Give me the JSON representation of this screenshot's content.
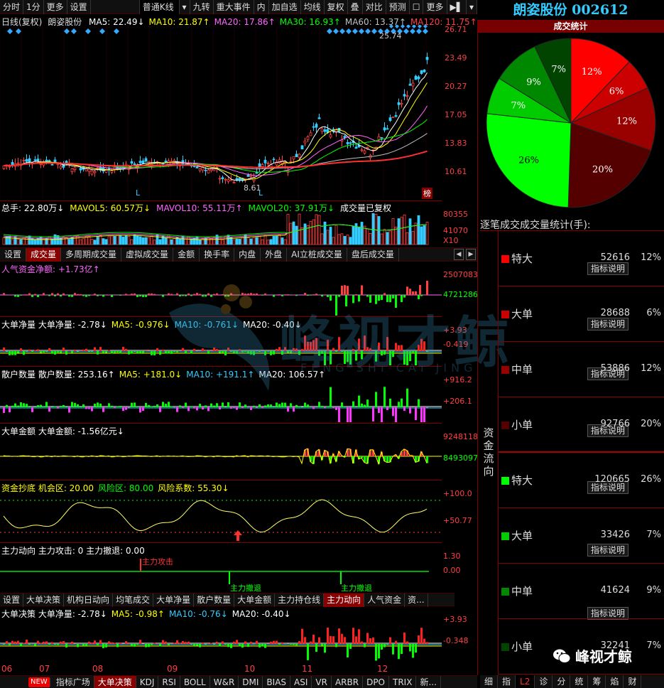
{
  "toolbar": {
    "items": [
      "分时",
      "1分",
      "更多",
      "设置"
    ],
    "chart_type": "普通K线",
    "buttons": [
      "九转",
      "重大事件",
      "内",
      "加自选",
      "均线",
      "复权",
      "叠",
      "对比",
      "预测",
      "更多"
    ]
  },
  "stock": {
    "name": "朗姿股份",
    "code": "002612"
  },
  "kline": {
    "info": "日线(复权)",
    "stock": "朗姿股份",
    "ma": [
      {
        "text": "MA5: 22.49↓",
        "color": "#ffffff"
      },
      {
        "text": "MA10: 21.87↑",
        "color": "#ffff00"
      },
      {
        "text": "MA20: 17.86↑",
        "color": "#ff66ff"
      },
      {
        "text": "MA30: 16.93↑",
        "color": "#00ff00"
      },
      {
        "text": "MA60: 13.37↑",
        "color": "#c0c0c0"
      },
      {
        "text": "MA120: 11.75↑",
        "color": "#ff4040"
      }
    ],
    "price_axis": [
      "26.71",
      "23.49",
      "20.27",
      "17.05",
      "13.83",
      "10.61"
    ],
    "high": "25.74",
    "low": "8.61",
    "sell_mark": "榜",
    "l_mark": "L"
  },
  "volume": {
    "items": [
      {
        "text": "总手: 22.80万↓",
        "color": "#ffffff"
      },
      {
        "text": "MAVOL5: 60.57万↓",
        "color": "#ffff00"
      },
      {
        "text": "MAVOL10: 55.11万↑",
        "color": "#ff66ff"
      },
      {
        "text": "MAVOL20: 37.91万↓",
        "color": "#00ff00"
      },
      {
        "text": "成交量已复权",
        "color": "#ffffff"
      }
    ],
    "axis": [
      "80355",
      "41070",
      "X10"
    ]
  },
  "tabs1": [
    "设置",
    "成交量",
    "多周期成交量",
    "虚拟成交量",
    "金额",
    "换手率",
    "内盘",
    "外盘",
    "AI立桩成交量",
    "盘后成交量"
  ],
  "explain": "指标说明",
  "p1": {
    "title": "人气资金净额: +1.73亿↑",
    "axis": [
      "2507083",
      "4721286"
    ]
  },
  "p2": {
    "parts": [
      {
        "text": "大单净量 大单净量: -2.78↓",
        "color": "#ffffff"
      },
      {
        "text": "MA5: -0.976↓",
        "color": "#ffff00"
      },
      {
        "text": "MA10: -0.761↓",
        "color": "#33ccff"
      },
      {
        "text": "MA20: -0.40↓",
        "color": "#ffffff"
      }
    ],
    "axis": [
      "+3.93",
      "-0.419"
    ]
  },
  "p3": {
    "parts": [
      {
        "text": "散户数量 散户数量: 253.16↑",
        "color": "#ffffff"
      },
      {
        "text": "MA5: +181.0↓",
        "color": "#ffff00"
      },
      {
        "text": "MA10: +191.1↑",
        "color": "#33ccff"
      },
      {
        "text": "MA20: 106.57↑",
        "color": "#ffffff"
      }
    ],
    "axis": [
      "+916.2",
      "+206.1"
    ]
  },
  "p4": {
    "title": "大单金额 大单金额: -1.56亿元↓",
    "axis": [
      "9248118",
      "8493097"
    ]
  },
  "p5": {
    "parts": [
      {
        "text": "资金抄底 机会区: 20.00",
        "color": "#ffff00"
      },
      {
        "text": "风险区: 80.00",
        "color": "#00ff00"
      },
      {
        "text": "风险系数: 55.30↓",
        "color": "#ffff00"
      }
    ],
    "axis": [
      "+100.0",
      "+50.77"
    ]
  },
  "p6": {
    "title": "主力动向 主力攻击: 0 主力撤退: 0.00",
    "axis": [
      "1.30",
      "0.00"
    ],
    "attack": "主力攻击",
    "retreat": "主力撤退"
  },
  "tabs2": [
    "设置",
    "大单决策",
    "机构日动向",
    "均笔成交",
    "大单净量",
    "散户数量",
    "大单金额",
    "主力持仓线",
    "主力动向",
    "人气资金",
    "资..."
  ],
  "p7": {
    "parts": [
      {
        "text": "大单决策 大单净量: -2.78↓",
        "color": "#ffffff"
      },
      {
        "text": "MA5: -0.98↑",
        "color": "#ffff00"
      },
      {
        "text": "MA10: -0.76↓",
        "color": "#33ccff"
      },
      {
        "text": "MA20: -0.40↓",
        "color": "#ffffff"
      }
    ],
    "axis": [
      "+3.93",
      "-0.348"
    ]
  },
  "months": [
    "06",
    "07",
    "08",
    "09",
    "10",
    "11",
    "12"
  ],
  "bottom_tabs": [
    "NEW",
    "指标广场",
    "大单决策",
    "KDJ",
    "RSI",
    "BOLL",
    "W&R",
    "DMI",
    "BIAS",
    "ASI",
    "VR",
    "ARBR",
    "DPO",
    "TRIX",
    "新..."
  ],
  "watermark": {
    "cn": "峰视才鲸",
    "en": "FENG SHI CAI JING"
  },
  "pie_title": "成交统计",
  "stats": {
    "title": "逐笔成交成交量统计(手):",
    "side": "资金流向",
    "rows": [
      {
        "name": "特大",
        "value": "52616",
        "pct": "12%",
        "color": "#ff0000"
      },
      {
        "name": "大单",
        "value": "28688",
        "pct": "6%",
        "color": "#cc0000"
      },
      {
        "name": "中单",
        "value": "53886",
        "pct": "12%",
        "color": "#990000"
      },
      {
        "name": "小单",
        "value": "92766",
        "pct": "20%",
        "color": "#550000"
      },
      {
        "name": "特大",
        "value": "120665",
        "pct": "26%",
        "color": "#00ff00"
      },
      {
        "name": "大单",
        "value": "33426",
        "pct": "7%",
        "color": "#00cc00"
      },
      {
        "name": "中单",
        "value": "41624",
        "pct": "9%",
        "color": "#008800"
      },
      {
        "name": "小单",
        "value": "32241",
        "pct": "7%",
        "color": "#004400"
      }
    ]
  },
  "right_tabs": [
    "细",
    "指",
    "L2",
    "诊",
    "分",
    "统",
    "筹",
    "焰",
    "财"
  ],
  "brand": "峰视才鲸",
  "chart_data": {
    "type": "pie",
    "title": "成交统计",
    "categories": [
      "特大(买)",
      "大单(买)",
      "中单(买)",
      "小单(买)",
      "特大(卖)",
      "大单(卖)",
      "中单(卖)",
      "小单(卖)"
    ],
    "values": [
      12,
      6,
      12,
      20,
      26,
      7,
      9,
      7
    ],
    "colors": [
      "#ff0000",
      "#cc0000",
      "#990000",
      "#550000",
      "#00ff00",
      "#00cc00",
      "#008800",
      "#004400"
    ]
  }
}
